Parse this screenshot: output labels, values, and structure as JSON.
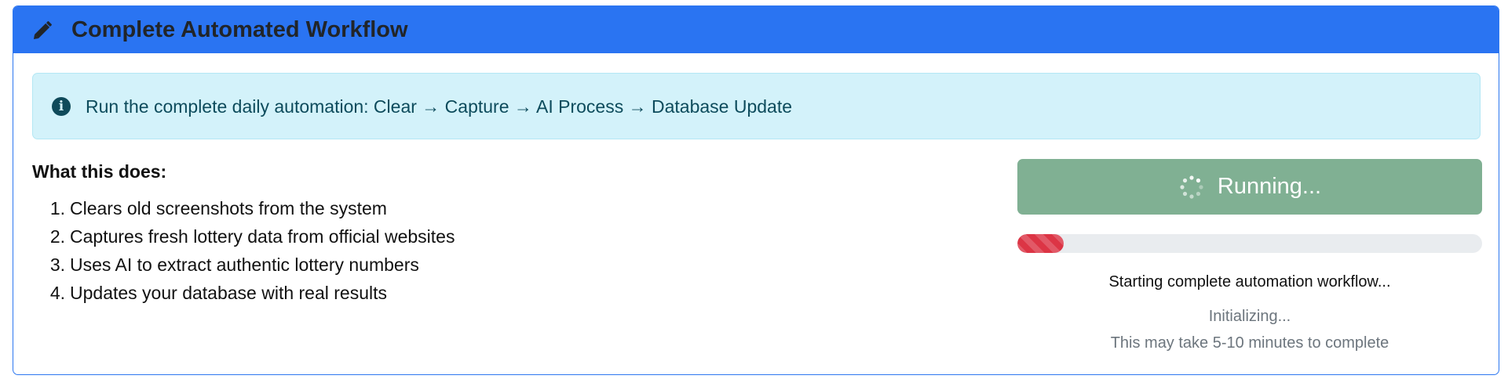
{
  "header": {
    "title": "Complete Automated Workflow",
    "icon": "pencil-icon",
    "background": "#2a74f2"
  },
  "alert": {
    "icon": "info-circle-icon",
    "text": "Run the complete daily automation: Clear → Capture → AI Process → Database Update",
    "background": "#d3f2fa"
  },
  "description": {
    "title": "What this does:",
    "steps": [
      {
        "num": "1.",
        "text": "Clears old screenshots from the system"
      },
      {
        "num": "2.",
        "text": "Captures fresh lottery data from official websites"
      },
      {
        "num": "3.",
        "text": "Uses AI to extract authentic lottery numbers"
      },
      {
        "num": "4.",
        "text": "Updates your database with real results"
      }
    ]
  },
  "run_button": {
    "label": "Running...",
    "icon": "spinner-icon",
    "background": "#80b093"
  },
  "progress": {
    "percent": 10,
    "color": "#dc3545"
  },
  "status": {
    "main": "Starting complete automation workflow...",
    "sub": "Initializing...",
    "note": "This may take 5-10 minutes to complete"
  }
}
